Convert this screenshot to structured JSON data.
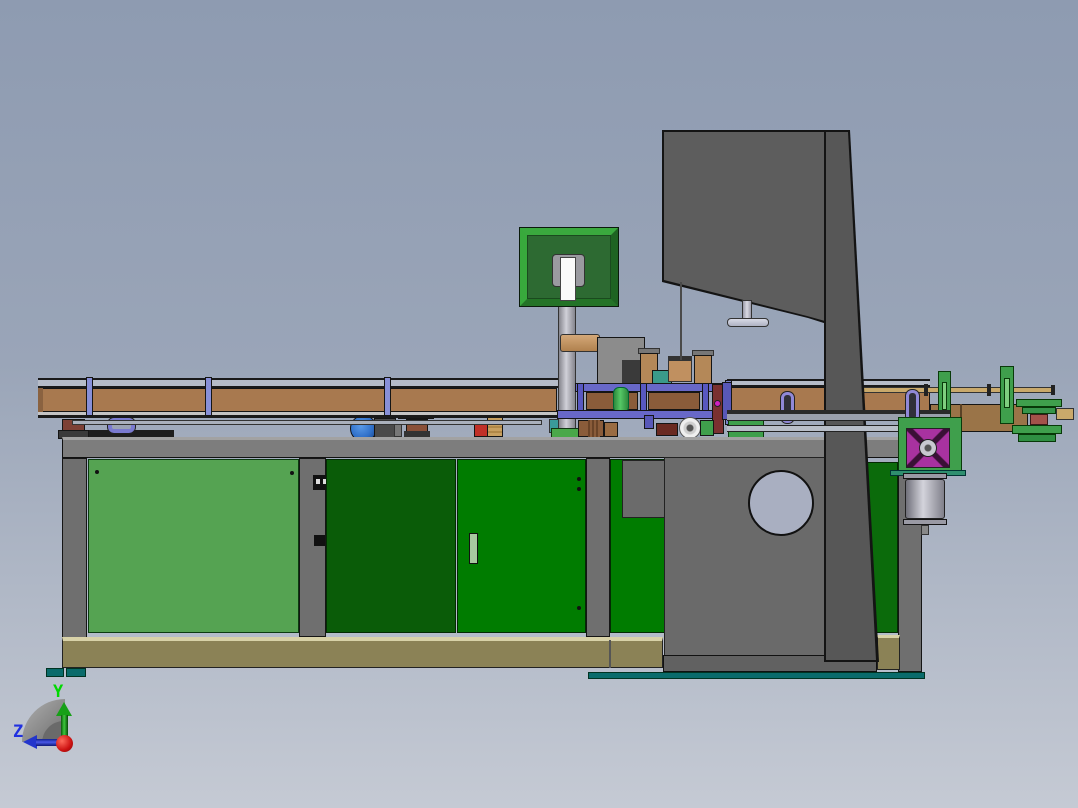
{
  "scene": {
    "description": "CAD 3D viewport, side view of an automated conveyor assembly machine",
    "view_orientation": "side (Y up, Z left)"
  },
  "triad": {
    "y_label": "Y",
    "z_label": "Z",
    "y_axis_color": "#00d800",
    "z_axis_color": "#2335cc",
    "origin_sphere_color": "#cc1111",
    "fan_color": "#8a8a8a"
  },
  "palette": {
    "background_top": "#8e9bb1",
    "background_bottom": "#c5cad4",
    "conveyor_brown": "#a8794f",
    "conveyor_post_blue": "#8890d8",
    "cabinet_door_light_green": "#55a352",
    "cabinet_door_dark_green": "#0a5c08",
    "cabinet_door_green": "#007c00",
    "table_gray": "#7d7d7d",
    "column_gray": "#5d5d5d",
    "column_dark_gray": "#575757",
    "base_khaki": "#8b8256",
    "base_trim_tan": "#d8d2a8",
    "baseplate_teal": "#0a6b6b",
    "monitor_bezel_green": "#38a93c",
    "monitor_back_green": "#2d6a32",
    "gearbox_purple": "#a832a0",
    "bracket_green": "#3f9f4c",
    "motor_silver": "#c8c8d2",
    "rod_tan": "#c9a96b",
    "hole_fill": "#a9afc1"
  }
}
